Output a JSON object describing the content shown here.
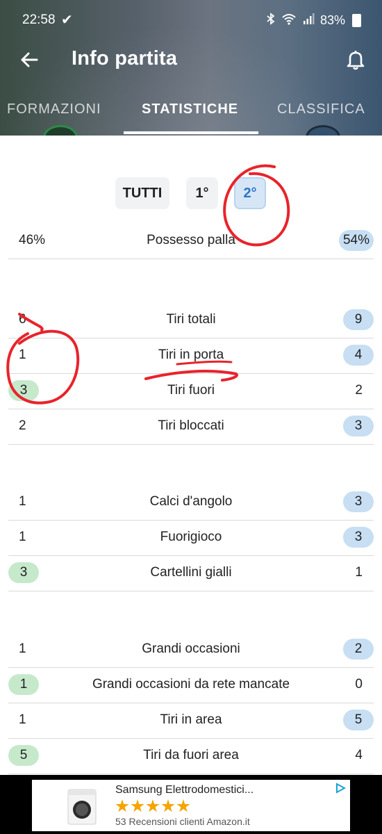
{
  "status_bar": {
    "time": "22:58",
    "battery": "83%"
  },
  "header": {
    "title": "Info partita"
  },
  "tabs": [
    {
      "label": "FORMAZIONI"
    },
    {
      "label": "STATISTICHE"
    },
    {
      "label": "CLASSIFICA"
    }
  ],
  "period_tabs": [
    {
      "label": "TUTTI"
    },
    {
      "label": "1°"
    },
    {
      "label": "2°"
    }
  ],
  "stats": [
    {
      "label": "Possesso palla",
      "home": "46%",
      "away": "54%",
      "highlight": "away"
    },
    {
      "label": "Tiri totali",
      "home": "6",
      "away": "9",
      "highlight": "away"
    },
    {
      "label": "Tiri in porta",
      "home": "1",
      "away": "4",
      "highlight": "away"
    },
    {
      "label": "Tiri fuori",
      "home": "3",
      "away": "2",
      "highlight": "home"
    },
    {
      "label": "Tiri bloccati",
      "home": "2",
      "away": "3",
      "highlight": "away"
    },
    {
      "label": "Calci d'angolo",
      "home": "1",
      "away": "3",
      "highlight": "away"
    },
    {
      "label": "Fuorigioco",
      "home": "1",
      "away": "3",
      "highlight": "away"
    },
    {
      "label": "Cartellini gialli",
      "home": "3",
      "away": "1",
      "highlight": "home"
    },
    {
      "label": "Grandi occasioni",
      "home": "1",
      "away": "2",
      "highlight": "away"
    },
    {
      "label": "Grandi occasioni da rete mancate",
      "home": "1",
      "away": "0",
      "highlight": "home"
    },
    {
      "label": "Tiri in area",
      "home": "1",
      "away": "5",
      "highlight": "away"
    },
    {
      "label": "Tiri da fuori area",
      "home": "5",
      "away": "4",
      "highlight": "home"
    }
  ],
  "ad": {
    "title": "Samsung Elettrodomestici...",
    "rating": 5,
    "subtitle": "53 Recensioni clienti Amazon.it"
  },
  "colors": {
    "home_highlight": "#c6e9cc",
    "away_highlight": "#c7def3",
    "active_period": "#2e74c4",
    "annotation": "#e8232b"
  }
}
